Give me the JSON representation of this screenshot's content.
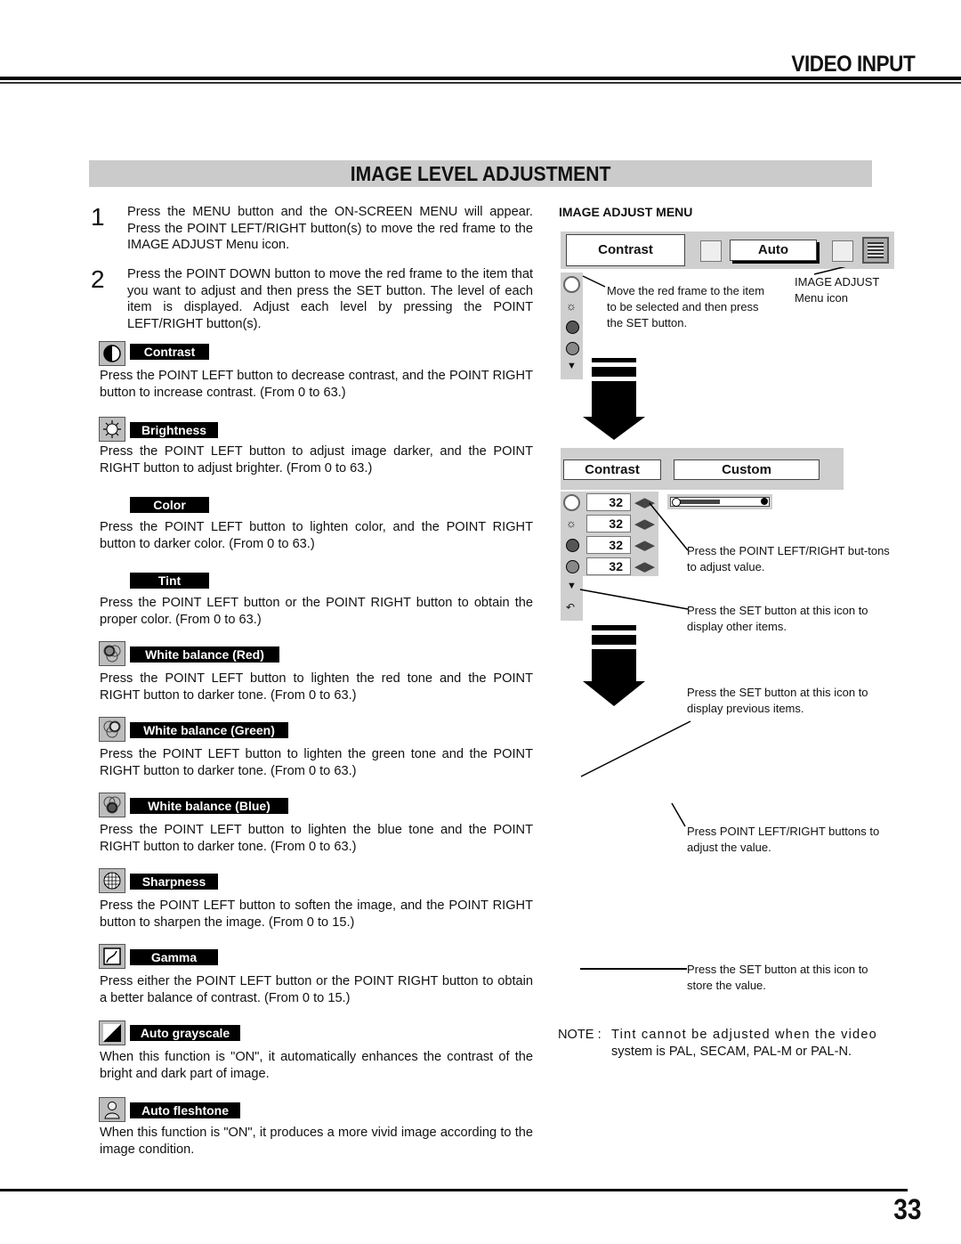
{
  "header": {
    "section_title": "VIDEO INPUT"
  },
  "page_title": "IMAGE LEVEL ADJUSTMENT",
  "steps": [
    {
      "number": "1",
      "text": "Press the MENU button and the ON-SCREEN MENU will appear.  Press the POINT LEFT/RIGHT button(s) to move the red frame to the IMAGE ADJUST Menu icon."
    },
    {
      "number": "2",
      "text": "Press the POINT DOWN button to move the red frame to the item that you want to adjust and then press the SET button.  The level of each item is displayed.  Adjust each level by pressing the POINT LEFT/RIGHT button(s)."
    }
  ],
  "items": [
    {
      "icon": "contrast-icon",
      "label": "Contrast",
      "text": "Press the POINT LEFT button to decrease contrast, and the POINT RIGHT button to increase contrast.  (From 0 to 63.)"
    },
    {
      "icon": "brightness-icon",
      "label": "Brightness",
      "text": "Press the POINT LEFT button to adjust image darker, and the POINT RIGHT button to adjust brighter.  (From 0 to 63.)"
    },
    {
      "icon": "",
      "label": "Color",
      "text": "Press the POINT LEFT button to lighten color, and the POINT RIGHT button to darker color.  (From 0 to 63.)"
    },
    {
      "icon": "",
      "label": "Tint",
      "text": "Press the POINT LEFT button or the POINT RIGHT button to obtain the proper color.  (From 0 to 63.)"
    },
    {
      "icon": "white-balance-red-icon",
      "label": "White balance (Red)",
      "text": "Press the POINT LEFT button to lighten the red tone and the POINT RIGHT button to darker tone.  (From 0 to 63.)"
    },
    {
      "icon": "white-balance-green-icon",
      "label": "White balance (Green)",
      "text": "Press the POINT LEFT button to lighten the green tone and the POINT RIGHT button to darker tone.  (From 0 to 63.)"
    },
    {
      "icon": "white-balance-blue-icon",
      "label": "White balance (Blue)",
      "text": "Press the POINT LEFT button to lighten the blue tone and the POINT RIGHT button to darker tone.  (From 0 to 63.)"
    },
    {
      "icon": "sharpness-icon",
      "label": "Sharpness",
      "text": "Press the POINT LEFT button to soften the image, and the POINT RIGHT button to sharpen the image.  (From 0 to 15.)"
    },
    {
      "icon": "gamma-icon",
      "label": "Gamma",
      "text": "Press either the POINT LEFT button or the POINT RIGHT button to obtain a better balance of contrast.  (From 0 to 15.)"
    },
    {
      "icon": "auto-grayscale-icon",
      "label": "Auto grayscale",
      "text": "When this function is \"ON\", it automatically enhances the contrast of the bright and dark part of image."
    },
    {
      "icon": "auto-fleshtone-icon",
      "label": "Auto fleshtone",
      "text": "When this function is \"ON\", it produces a more vivid image according to the image condition."
    }
  ],
  "image_adjust_menu": {
    "heading": "IMAGE ADJUST MENU",
    "osd1": {
      "item": "Contrast",
      "mode": "Auto"
    },
    "osd2": {
      "item": "Contrast",
      "mode": "Custom",
      "values": [
        "32",
        "32",
        "32",
        "32"
      ],
      "slider_fraction": 0.5
    },
    "callouts": {
      "menu_icon": "IMAGE ADJUST Menu icon",
      "move_frame": "Move the red frame to the item to be selected and then press the SET button.",
      "adjust_value": "Press the POINT LEFT/RIGHT but-tons to adjust value.",
      "other_items": "Press the SET button at this icon to display other items.",
      "previous_items": "Press the SET button at this icon to display previous items.",
      "adjust_value2": "Press POINT LEFT/RIGHT buttons to adjust the value.",
      "store_value": "Press the SET button at this icon to store the value."
    }
  },
  "note": {
    "prefix": "NOTE :",
    "text1": "Tint cannot be adjusted when the video",
    "text2": "system is PAL, SECAM, PAL-M or PAL-N."
  },
  "page_number": "33"
}
